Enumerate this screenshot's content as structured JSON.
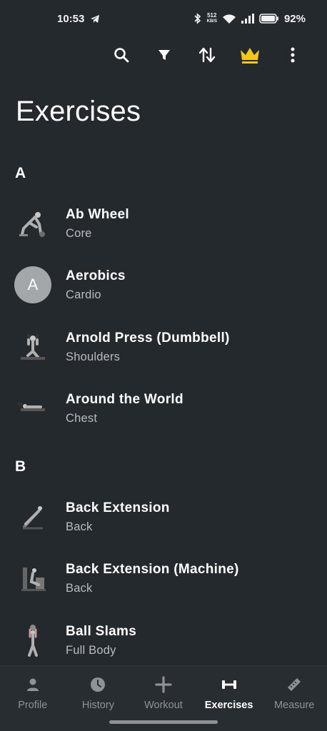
{
  "status_bar": {
    "time": "10:53",
    "net_speed_value": "512",
    "net_speed_unit": "KB/S",
    "battery": "92%"
  },
  "toolbar": {
    "icons": [
      "search-icon",
      "filter-icon",
      "sort-icon",
      "crown-icon",
      "more-vert-icon"
    ],
    "crown_color": "#f5c518"
  },
  "page_title": "Exercises",
  "sections": [
    {
      "letter": "A",
      "items": [
        {
          "name": "Ab Wheel",
          "category": "Core",
          "thumb": "image"
        },
        {
          "name": "Aerobics",
          "category": "Cardio",
          "thumb": "letter",
          "letter": "A"
        },
        {
          "name": "Arnold Press (Dumbbell)",
          "category": "Shoulders",
          "thumb": "image"
        },
        {
          "name": "Around the World",
          "category": "Chest",
          "thumb": "image"
        }
      ]
    },
    {
      "letter": "B",
      "items": [
        {
          "name": "Back Extension",
          "category": "Back",
          "thumb": "image"
        },
        {
          "name": "Back Extension (Machine)",
          "category": "Back",
          "thumb": "image"
        },
        {
          "name": "Ball Slams",
          "category": "Full Body",
          "thumb": "image"
        }
      ]
    }
  ],
  "bottom_nav": [
    {
      "label": "Profile",
      "icon": "person-icon",
      "active": false
    },
    {
      "label": "History",
      "icon": "clock-icon",
      "active": false
    },
    {
      "label": "Workout",
      "icon": "plus-icon",
      "active": false
    },
    {
      "label": "Exercises",
      "icon": "dumbbell-icon",
      "active": true
    },
    {
      "label": "Measure",
      "icon": "ruler-icon",
      "active": false
    }
  ]
}
